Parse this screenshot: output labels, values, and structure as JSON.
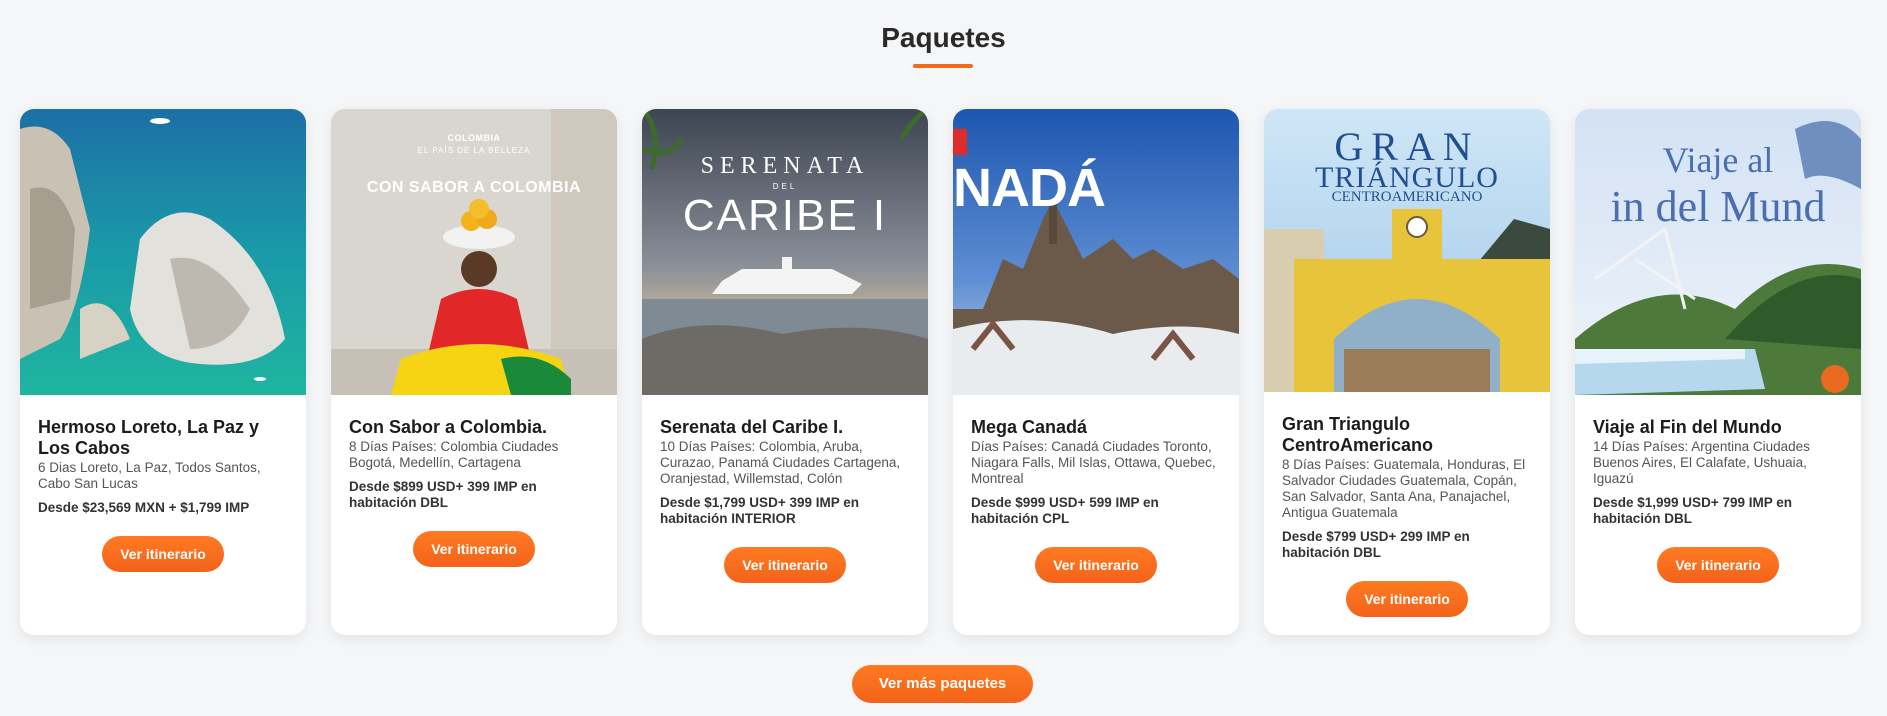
{
  "section": {
    "title": "Paquetes"
  },
  "cards": [
    {
      "title": "Hermoso Loreto, La Paz y Los Cabos",
      "desc": "6 Dias Loreto, La Paz, Todos Santos, Cabo San Lucas",
      "price": "Desde $23,569 MXN + $1,799 IMP",
      "button": "Ver itinerario"
    },
    {
      "title": "Con Sabor a Colombia.",
      "desc": "8 Días Países: Colombia Ciudades Bogotá, Medellín, Cartagena",
      "price": "Desde $899 USD+ 399 IMP en habitación DBL",
      "button": "Ver itinerario",
      "img_brand": "COLOMBIA",
      "img_tagline": "EL PAÍS DE LA BELLEZA",
      "img_heading": "CON SABOR A COLOMBIA"
    },
    {
      "title": "Serenata del Caribe I.",
      "desc": "10 Días Países: Colombia, Aruba, Curazao, Panamá Ciudades Cartagena, Oranjestad, Willemstad, Colón",
      "price": "Desde $1,799 USD+ 399 IMP en habitación INTERIOR",
      "button": "Ver itinerario",
      "img_line1": "SERENATA",
      "img_line2": "DEL",
      "img_line3": "CARIBE I"
    },
    {
      "title": "Mega Canadá",
      "desc": "Días Países: Canadá Ciudades Toronto, Niagara Falls, Mil Islas, Ottawa, Quebec, Montreal",
      "price": "Desde $999 USD+ 599 IMP en habitación CPL",
      "button": "Ver itinerario",
      "img_heading": "NADÁ"
    },
    {
      "title": "Gran Triangulo CentroAmericano",
      "desc": "8 Días Países: Guatemala, Honduras, El Salvador Ciudades Guatemala, Copán, San Salvador, Santa Ana, Panajachel, Antigua Guatemala",
      "price": "Desde $799 USD+ 299 IMP en habitación DBL",
      "button": "Ver itinerario",
      "img_line1": "GRAN",
      "img_line2": "TRIÁNGULO",
      "img_line3": "CENTROAMERICANO"
    },
    {
      "title": "Viaje al Fin del Mundo",
      "desc": "14 Días Países: Argentina Ciudades Buenos Aires, El Calafate, Ushuaia, Iguazú",
      "price": "Desde $1,999 USD+ 799 IMP en habitación DBL",
      "button": "Ver itinerario",
      "img_line1": "Viaje al",
      "img_line2": "in del Mund"
    }
  ],
  "more_button": "Ver más paquetes",
  "colors": {
    "accent": "#f26b1d",
    "background": "#f5f6f8"
  }
}
